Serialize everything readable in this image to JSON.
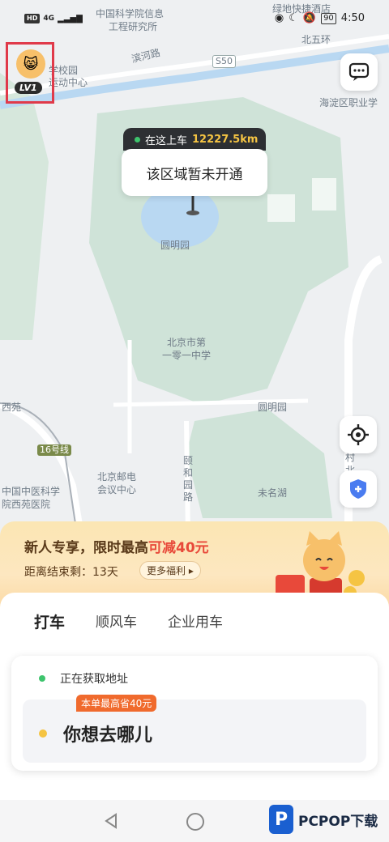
{
  "status_bar": {
    "hd": "HD",
    "network": "4G",
    "battery": "90",
    "time": "4:50"
  },
  "map": {
    "labels": [
      {
        "text": "中国科学院信息"
      },
      {
        "text": "工程研究所"
      },
      {
        "text": "绿地快捷酒店"
      },
      {
        "text": "北五环"
      },
      {
        "text": "S50"
      },
      {
        "text": "滨河路"
      },
      {
        "text": "学校园"
      },
      {
        "text": "运动中心"
      },
      {
        "text": "海淀区职业学"
      },
      {
        "text": "圆明园"
      },
      {
        "text": "北京市第"
      },
      {
        "text": "一零一中学"
      },
      {
        "text": "圆明园"
      },
      {
        "text": "西苑"
      },
      {
        "text": "16号线"
      },
      {
        "text": "北京邮电"
      },
      {
        "text": "会议中心"
      },
      {
        "text": "颐"
      },
      {
        "text": "和"
      },
      {
        "text": "园"
      },
      {
        "text": "路"
      },
      {
        "text": "未名湖"
      },
      {
        "text": "中国中医科学"
      },
      {
        "text": "院西苑医院"
      },
      {
        "text": "村"
      },
      {
        "text": "北"
      }
    ],
    "pin": {
      "tag_label": "在这上车",
      "distance": "12227.5km",
      "message": "该区域暂未开通"
    }
  },
  "user": {
    "level": "LV1"
  },
  "icons": {
    "message": "message-icon",
    "locate": "crosshair-icon",
    "safety": "shield-icon"
  },
  "promo": {
    "title_prefix": "新人专享，限时最高",
    "title_highlight": "可减40元",
    "countdown": "距离结束剩：13天",
    "more_label": "更多福利"
  },
  "tabs": [
    "打车",
    "顺风车",
    "企业用车"
  ],
  "trip": {
    "pickup": "正在获取地址",
    "badge": "本单最高省40元",
    "destination_placeholder": "你想去哪儿"
  },
  "watermark": {
    "letter": "P",
    "text": "PCPOP下载"
  },
  "colors": {
    "accent": "#f7c843",
    "badge": "#f06a2d",
    "pickup_dot": "#3ec46d",
    "highlight": "#e8493a"
  }
}
